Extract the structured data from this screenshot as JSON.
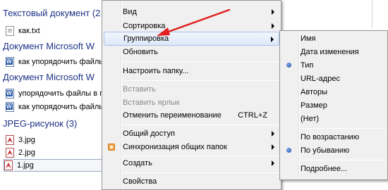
{
  "explorer": {
    "groups": [
      {
        "title": "Текстовый документ (2",
        "files": [
          "как.txt"
        ]
      },
      {
        "title": "Документ Microsoft W",
        "files": [
          "как упорядочить файлы"
        ]
      },
      {
        "title": "Документ Microsoft W",
        "files": [
          "упорядочить файлы в па",
          "как упорядочить файлы"
        ]
      },
      {
        "title": "JPEG-рисунок (3)",
        "files": [
          "3.jpg",
          "2.jpg",
          "1.jpg"
        ]
      }
    ]
  },
  "context_menu": {
    "items": [
      {
        "label": "Вид"
      },
      {
        "label": "Сортировка"
      },
      {
        "label": "Группировка"
      },
      {
        "label": "Обновить"
      },
      {
        "label": "Настроить папку..."
      },
      {
        "label": "Вставить"
      },
      {
        "label": "Вставить ярлык"
      },
      {
        "label": "Отменить переименование",
        "shortcut": "CTRL+Z"
      },
      {
        "label": "Общий доступ"
      },
      {
        "label": "Синхронизация общих папок"
      },
      {
        "label": "Создать"
      },
      {
        "label": "Свойства"
      }
    ]
  },
  "group_submenu": {
    "items": [
      {
        "label": "Имя"
      },
      {
        "label": "Дата изменения"
      },
      {
        "label": "Тип",
        "selected": true
      },
      {
        "label": "URL-адрес"
      },
      {
        "label": "Авторы"
      },
      {
        "label": "Размер"
      },
      {
        "label": "(Нет)"
      },
      {
        "label": "По возрастанию"
      },
      {
        "label": "По убыванию",
        "selected": true
      },
      {
        "label": "Подробнее..."
      }
    ]
  },
  "annotation": {
    "color": "#e02020"
  },
  "icons": [
    "txt-file-icon",
    "word-doc-icon",
    "jpeg-file-icon",
    "submenu-arrow-icon",
    "radio-dot-icon",
    "sync-folder-icon",
    "red-pointer-arrow"
  ]
}
